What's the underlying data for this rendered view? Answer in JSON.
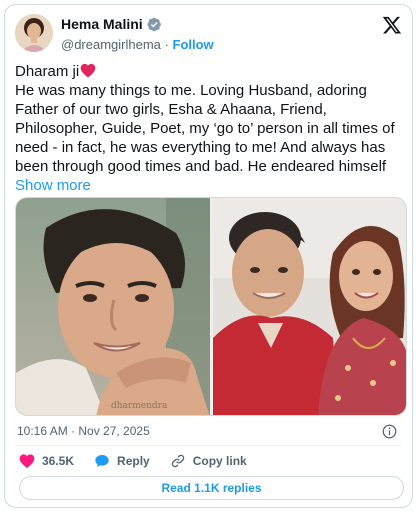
{
  "post": {
    "author": {
      "display_name": "Hema Malini",
      "handle": "@dreamgirlhema",
      "separator": "·",
      "follow_label": "Follow",
      "verified": true
    },
    "text": {
      "greeting": "Dharam ji",
      "body": "He was many things to me. Loving Husband, adoring Father of our two girls, Esha & Ahaana, Friend, Philosopher, Guide, Poet, my ‘go to’ person in all times of need - in fact, he was everything to me! And always has been through good times and bad. He endeared himself",
      "show_more_label": "Show more"
    },
    "timestamp": "10:16 AM · Nov 27, 2025",
    "actions": {
      "like_count": "36.5K",
      "reply_label": "Reply",
      "copy_link_label": "Copy link"
    },
    "read_replies_label": "Read 1.1K replies"
  },
  "colors": {
    "accent": "#1d9bf0",
    "like": "#f91880",
    "heart_emoji": "#e0245e",
    "text_primary": "#0f1419",
    "text_secondary": "#536471",
    "border": "#cfd9de"
  },
  "icons": {
    "verified": "verified-badge-icon",
    "logo": "x-logo-icon",
    "heart_emoji": "heart-emoji-icon",
    "info": "info-icon",
    "like": "like-heart-icon",
    "reply": "reply-bubble-icon",
    "copy_link": "link-icon"
  }
}
